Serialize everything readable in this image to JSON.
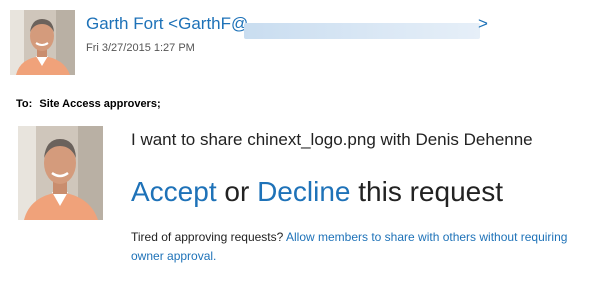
{
  "sender": {
    "name_prefix": "Garth Fort <GarthF@",
    "email_suffix": ">",
    "timestamp": "Fri 3/27/2015 1:27 PM"
  },
  "recipients": {
    "label": "To:",
    "value": "Site Access approvers;"
  },
  "request": {
    "message": "I want to share chinext_logo.png with Denis Dehenne",
    "accept_label": "Accept",
    "or_text": " or ",
    "decline_label": "Decline",
    "tail_text": " this request"
  },
  "footer": {
    "question": "Tired of approving requests?",
    "link_label": "Allow members to share with others without requiring owner approval."
  },
  "colors": {
    "link": "#1e72b8",
    "text": "#222222"
  },
  "icons": {
    "sender_avatar": "person-photo",
    "request_avatar": "person-photo"
  }
}
